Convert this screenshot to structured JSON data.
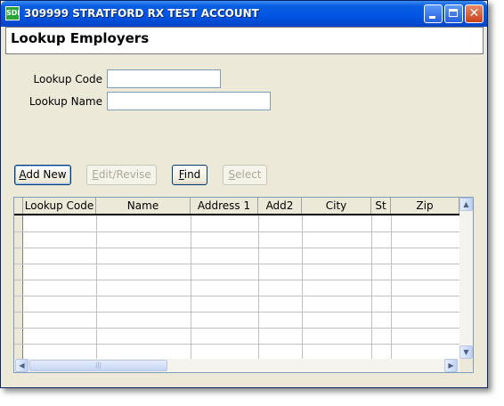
{
  "window": {
    "title": "309999 STRATFORD RX TEST ACCOUNT",
    "app_icon_text": "SDI"
  },
  "header": {
    "title": "Lookup Employers"
  },
  "form": {
    "lookup_code_label": "Lookup Code",
    "lookup_code_value": "",
    "lookup_name_label": "Lookup Name",
    "lookup_name_value": ""
  },
  "toolbar": {
    "add_new": {
      "pre": "",
      "key": "A",
      "post": "dd New",
      "enabled": true
    },
    "edit_revise": {
      "pre": "",
      "key": "E",
      "post": "dit/Revise",
      "enabled": false
    },
    "find": {
      "pre": "",
      "key": "F",
      "post": "ind",
      "enabled": true
    },
    "select": {
      "pre": "",
      "key": "S",
      "post": "elect",
      "enabled": false
    }
  },
  "grid": {
    "columns": [
      "Lookup Code",
      "Name",
      "Address 1",
      "Add2",
      "City",
      "St",
      "Zip"
    ],
    "rows": []
  },
  "icons": {
    "close": "close-icon",
    "minimize": "minimize-icon",
    "maximize": "maximize-icon",
    "scroll_up": "arrow-up-icon",
    "scroll_down": "arrow-down-icon",
    "scroll_left": "arrow-left-icon",
    "scroll_right": "arrow-right-icon"
  }
}
